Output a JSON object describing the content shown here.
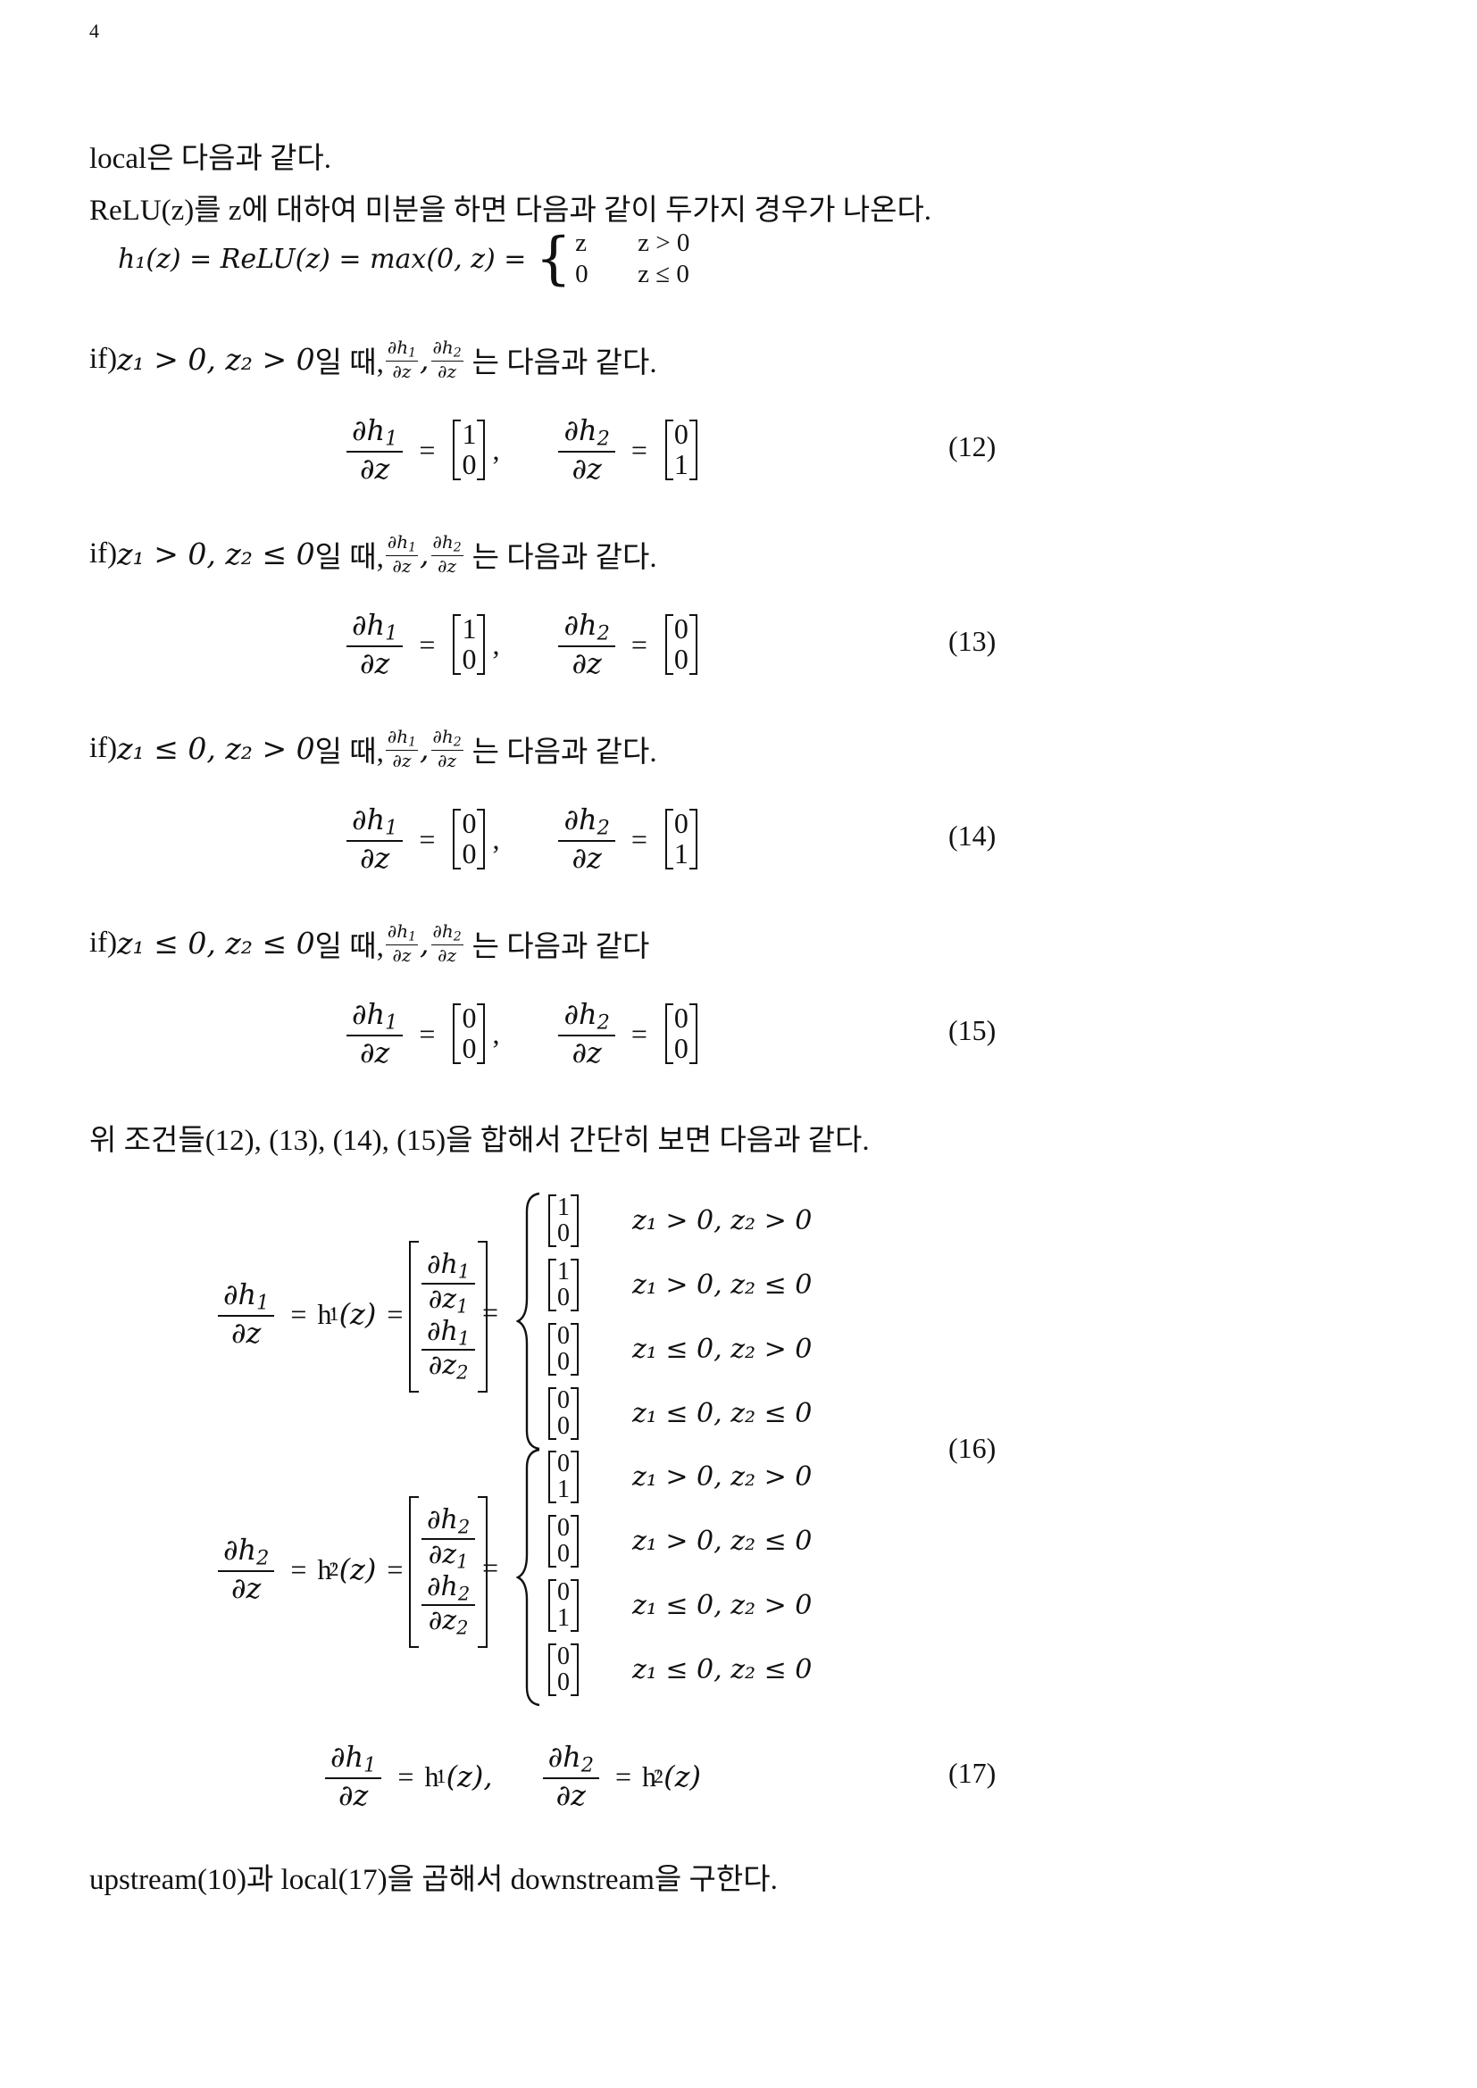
{
  "page_number": "4",
  "intro": {
    "line1": "local은 다음과 같다.",
    "line2": "ReLU(z)를 z에 대하여 미분을 하면 다음과 같이 두가지 경우가 나온다."
  },
  "relu_def": {
    "lhs": "h₁(z) = ReLU(z) = max(0,  z) =",
    "case1_value": "z",
    "case1_cond": "z > 0",
    "case2_value": "0",
    "case2_cond": "z ≤ 0"
  },
  "conditions": [
    {
      "prefix": "if) ",
      "cond": "z₁ > 0, z₂ > 0",
      "suffix": "일 때,",
      "tail": "는 다음과 같다.",
      "h1": [
        "1",
        "0"
      ],
      "h2": [
        "0",
        "1"
      ],
      "eqno": "(12)"
    },
    {
      "prefix": "if) ",
      "cond": "z₁ > 0, z₂ ≤ 0",
      "suffix": "일 때,",
      "tail": "는 다음과 같다.",
      "h1": [
        "1",
        "0"
      ],
      "h2": [
        "0",
        "0"
      ],
      "eqno": "(13)"
    },
    {
      "prefix": "if) ",
      "cond": "z₁ ≤ 0, z₂ > 0",
      "suffix": "일 때,",
      "tail": "는 다음과 같다.",
      "h1": [
        "0",
        "0"
      ],
      "h2": [
        "0",
        "1"
      ],
      "eqno": "(14)"
    },
    {
      "prefix": "if) ",
      "cond": "z₁ ≤ 0, z₂ ≤ 0",
      "suffix": "일 때,",
      "tail": "는 다음과 같다",
      "h1": [
        "0",
        "0"
      ],
      "h2": [
        "0",
        "0"
      ],
      "eqno": "(15)"
    }
  ],
  "combined_text": "위 조건들(12), (13), (14), (15)을 합해서 간단히 보면 다음과 같다.",
  "eq16": {
    "eqno": "(16)",
    "h1_cases": [
      {
        "vec": [
          "1",
          "0"
        ],
        "cond": "z₁ > 0, z₂ > 0"
      },
      {
        "vec": [
          "1",
          "0"
        ],
        "cond": "z₁ > 0, z₂ ≤ 0"
      },
      {
        "vec": [
          "0",
          "0"
        ],
        "cond": "z₁ ≤ 0, z₂ > 0"
      },
      {
        "vec": [
          "0",
          "0"
        ],
        "cond": "z₁ ≤ 0, z₂ ≤ 0"
      }
    ],
    "h2_cases": [
      {
        "vec": [
          "0",
          "1"
        ],
        "cond": "z₁ > 0, z₂ > 0"
      },
      {
        "vec": [
          "0",
          "0"
        ],
        "cond": "z₁ > 0, z₂ ≤ 0"
      },
      {
        "vec": [
          "0",
          "1"
        ],
        "cond": "z₁ ≤ 0, z₂ > 0"
      },
      {
        "vec": [
          "0",
          "0"
        ],
        "cond": "z₁ ≤ 0, z₂ ≤ 0"
      }
    ]
  },
  "eq17": {
    "eqno": "(17)"
  },
  "final_text": "upstream(10)과 local(17)을 곱해서 downstream을 구한다."
}
